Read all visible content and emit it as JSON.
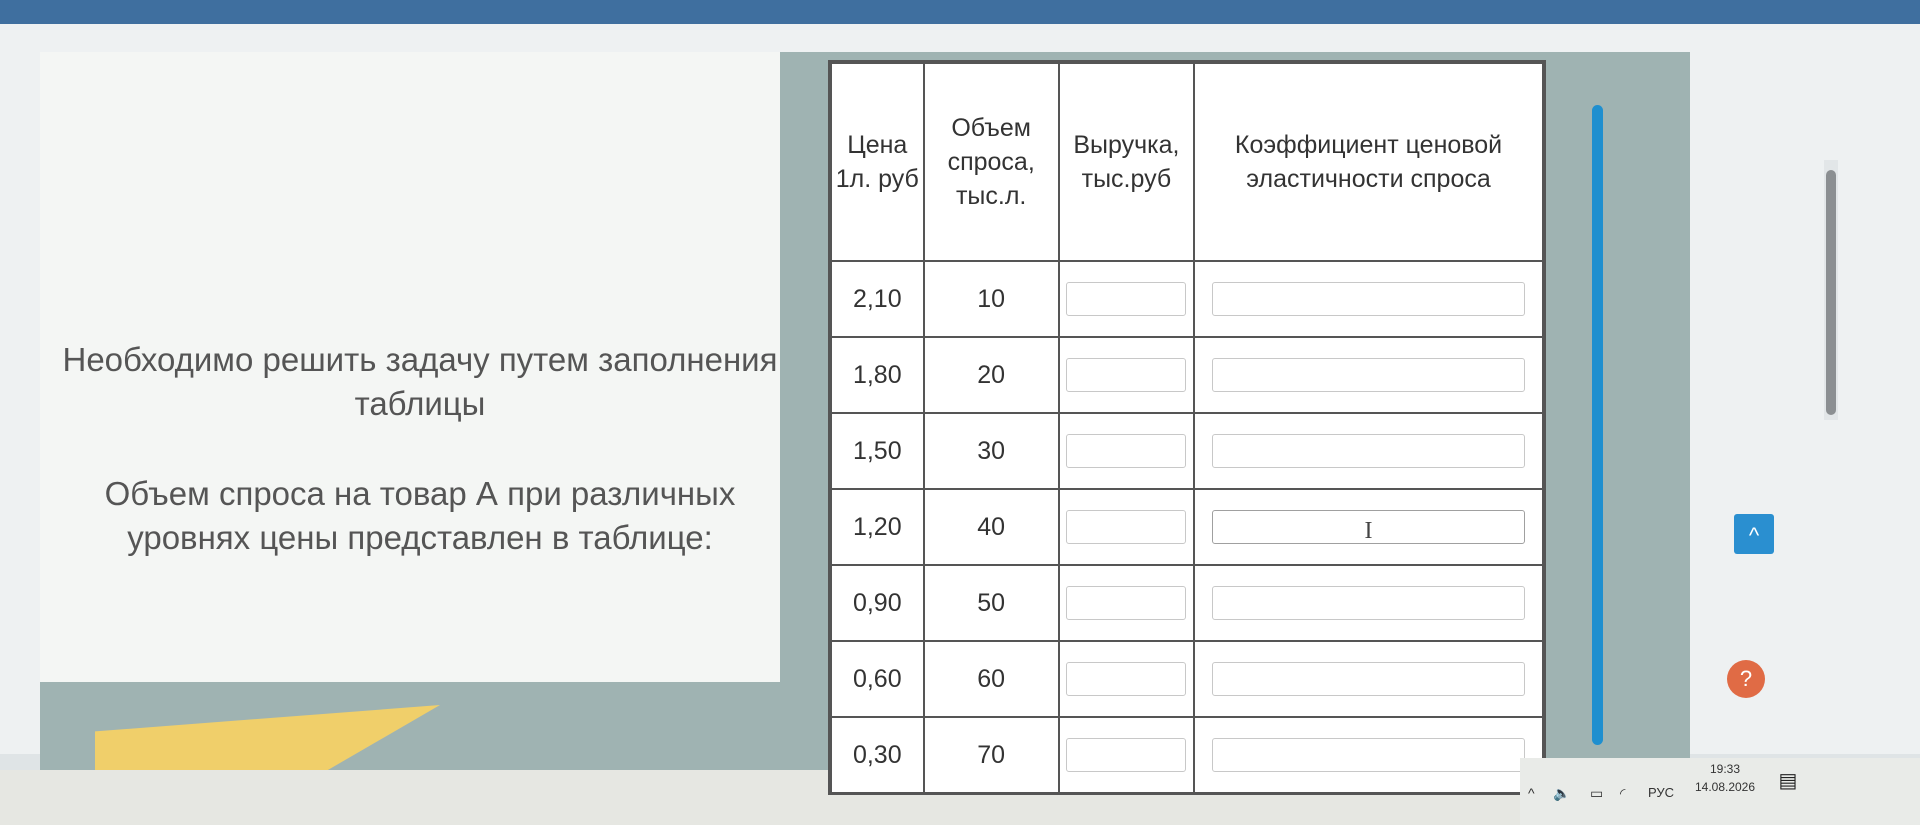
{
  "slide": {
    "instruction": "Необходимо решить задачу путем заполнения таблицы",
    "description": "Объем спроса на товар А при различных уровнях цены представлен в таблице:"
  },
  "table": {
    "headers": [
      "Цена 1л. руб",
      "Объем спроса, тыс.л.",
      "Выручка, тыс.руб",
      "Коэффициент ценовой эластичности спроса"
    ],
    "rows": [
      {
        "price": "2,10",
        "volume": "10",
        "revenue": "",
        "elasticity": ""
      },
      {
        "price": "1,80",
        "volume": "20",
        "revenue": "",
        "elasticity": ""
      },
      {
        "price": "1,50",
        "volume": "30",
        "revenue": "",
        "elasticity": ""
      },
      {
        "price": "1,20",
        "volume": "40",
        "revenue": "",
        "elasticity": ""
      },
      {
        "price": "0,90",
        "volume": "50",
        "revenue": "",
        "elasticity": ""
      },
      {
        "price": "0,60",
        "volume": "60",
        "revenue": "",
        "elasticity": ""
      },
      {
        "price": "0,30",
        "volume": "70",
        "revenue": "",
        "elasticity": ""
      }
    ]
  },
  "ui": {
    "scroll_up_icon": "^",
    "help_icon": "?",
    "text_cursor_icon": "I"
  },
  "taskbar": {
    "chevron_icon": "^",
    "volume_icon": "🔈",
    "battery_icon": "▭",
    "wifi_icon": "◜",
    "language": "РУС",
    "time": "19:33",
    "date": "14.08.2026",
    "notification_icon": "▤"
  }
}
